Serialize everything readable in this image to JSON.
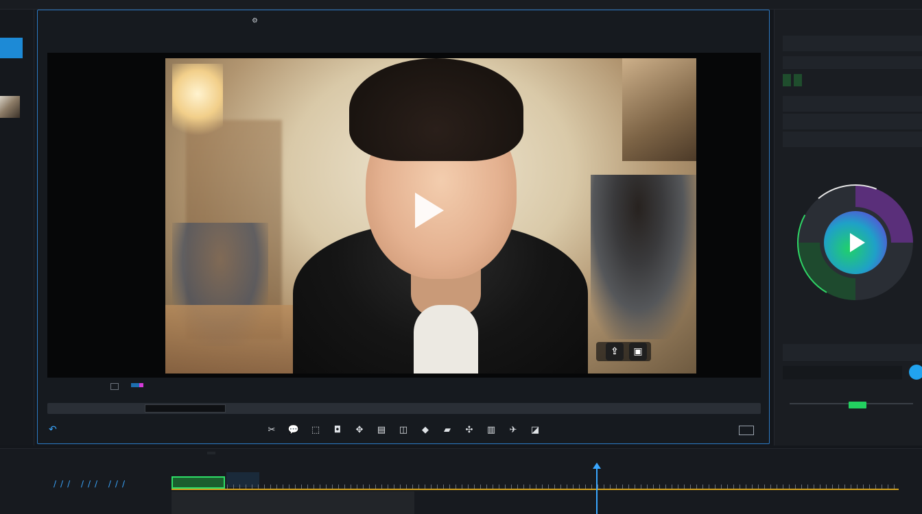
{
  "topbar": {},
  "left_toolbar": {
    "active_label": "",
    "items": [
      "",
      "",
      "",
      "",
      "",
      "",
      "",
      "",
      ""
    ]
  },
  "preview": {
    "tabs": [
      "",
      "",
      "",
      "",
      "",
      ""
    ],
    "active_tab": "",
    "sub_label": "",
    "overlay_text": "",
    "control_title": "",
    "control_right": [
      "",
      ""
    ]
  },
  "right_panel": {
    "title": "",
    "section1": "",
    "tab_labels": [
      "",
      ""
    ],
    "rows": [
      "",
      "",
      ""
    ],
    "color_wheel_title": "",
    "section2": "",
    "section3": "",
    "input_placeholder": "",
    "slider_label": "",
    "footer_left": "",
    "footer_right": ""
  },
  "timeline": {
    "header": "",
    "track_title": "",
    "tab_labels": [
      "",
      ""
    ],
    "clip_label": ""
  },
  "icons": {
    "play": "play-icon",
    "share": "share-icon",
    "caption": "caption-icon"
  },
  "colors": {
    "accent": "#3aa7ff",
    "selection": "#1d8ad6",
    "timeline_line": "#d7a51e",
    "clip_green": "#2fe068"
  }
}
